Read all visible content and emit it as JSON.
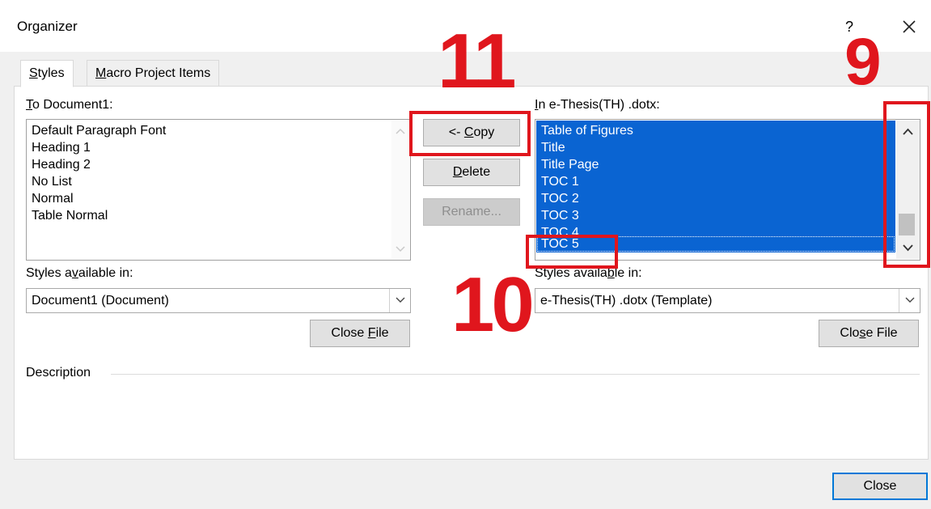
{
  "window": {
    "title": "Organizer",
    "help_glyph": "?",
    "close_glyph": "✕"
  },
  "tabs": [
    {
      "label": "Styles",
      "underline": "S",
      "rest": "tyles",
      "active": true
    },
    {
      "label": "Macro Project Items",
      "underline": "M",
      "rest": "acro Project Items",
      "active": false
    }
  ],
  "left_panel": {
    "to_label_u": "T",
    "to_label_rest": "o Document1:",
    "items": [
      "Default Paragraph Font",
      "Heading 1",
      "Heading 2",
      "No List",
      "Normal",
      "Table Normal"
    ],
    "available_label_pre": "Styles a",
    "available_label_u": "v",
    "available_label_post": "ailable in:",
    "available_value": "Document1 (Document)",
    "close_file_pre": "Close ",
    "close_file_u": "F",
    "close_file_post": "ile"
  },
  "middle_buttons": {
    "copy_pre": "<- ",
    "copy_u": "C",
    "copy_post": "opy",
    "delete_u": "D",
    "delete_post": "elete",
    "rename": "Rename..."
  },
  "right_panel": {
    "in_label_u": "I",
    "in_label_rest": "n e-Thesis(TH) .dotx:",
    "items": [
      "Table of Figures",
      "Title",
      "Title Page",
      "TOC 1",
      "TOC 2",
      "TOC 3",
      "TOC 4",
      "TOC 5"
    ],
    "available_label_pre": "Styles availa",
    "available_label_u": "b",
    "available_label_post": "le in:",
    "available_value": "e-Thesis(TH) .dotx (Template)",
    "close_file_pre": "Clo",
    "close_file_u": "s",
    "close_file_post": "e File"
  },
  "description": {
    "label": "Description"
  },
  "footer": {
    "close": "Close"
  },
  "annotations": {
    "step_copy": "11",
    "step_scroll": "9",
    "step_item": "10",
    "color": "#e0161d"
  },
  "colors": {
    "selection": "#0a64d2",
    "dialog_bg": "#f0f0f0",
    "focus_border": "#0078d7"
  }
}
